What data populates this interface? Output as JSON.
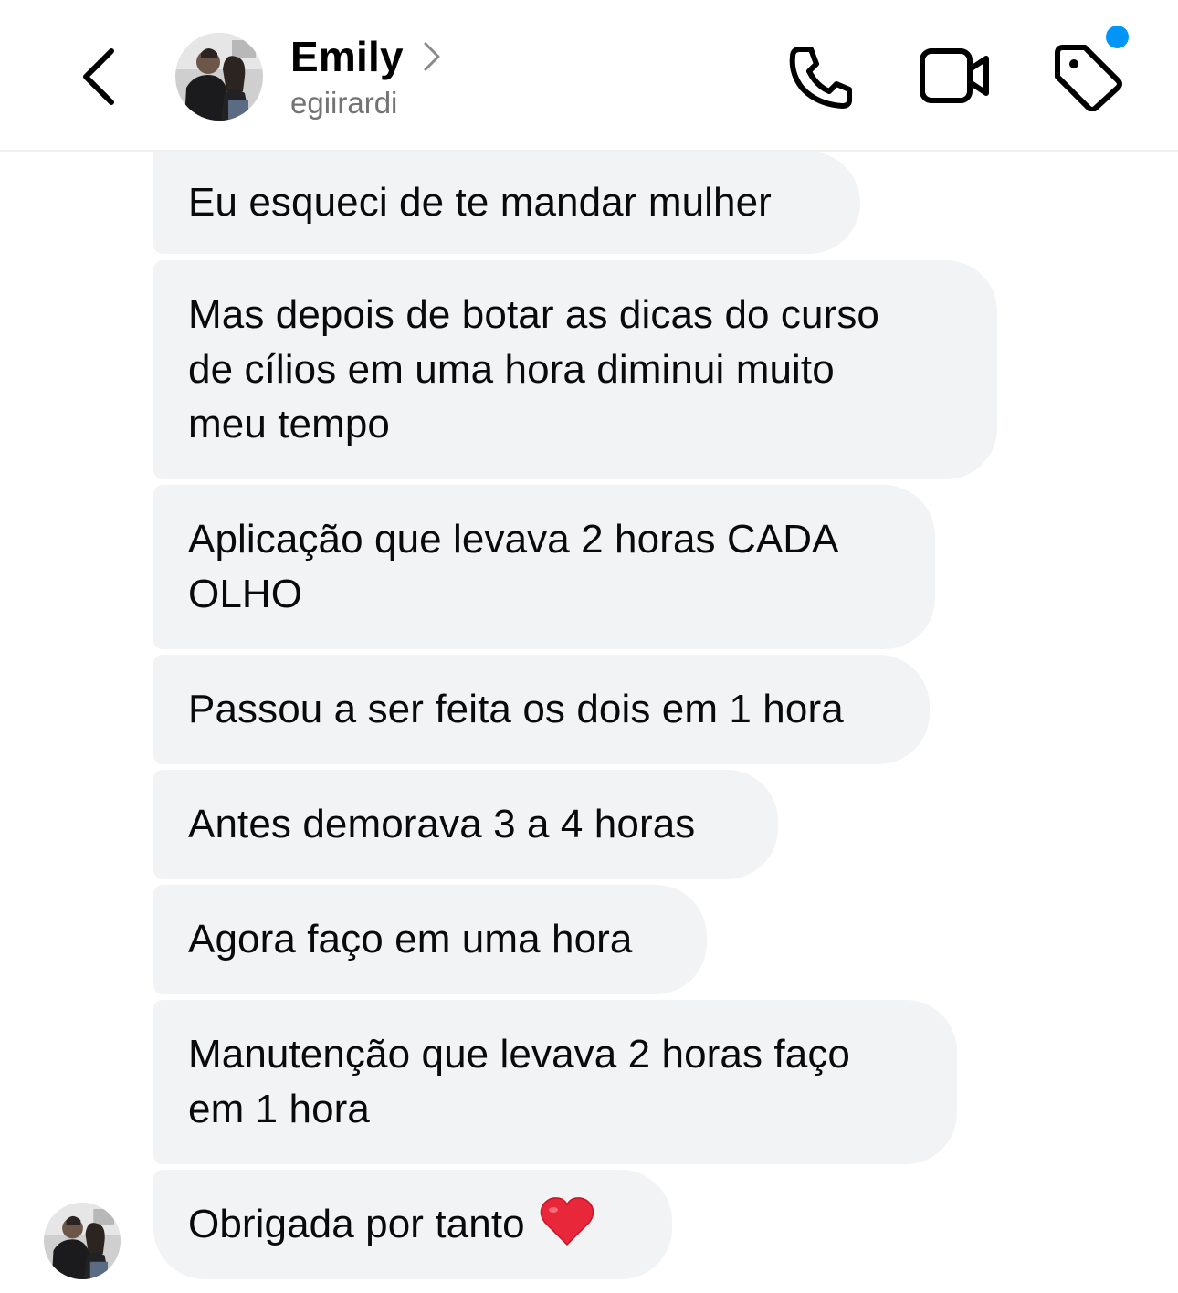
{
  "header": {
    "contact_name": "Emily",
    "contact_handle": "egiirardi",
    "icons": {
      "back": "chevron-left-icon",
      "profile_arrow": "chevron-right-icon",
      "call": "phone-icon",
      "video": "video-camera-icon",
      "tag": "tag-icon"
    },
    "notification_dot_color": "#0095f6"
  },
  "messages": [
    "Eu esqueci de te mandar mulher",
    "Mas depois de botar as dicas do curso\nde cílios em uma hora diminui muito\nmeu tempo",
    "Aplicação que levava 2 horas CADA\nOLHO",
    "Passou a ser feita os dois em 1 hora",
    "Antes demorava 3 a 4 horas",
    "Agora faço em uma hora",
    "Manutenção que levava 2 horas faço\nem 1 hora",
    "Obrigada por tanto"
  ],
  "last_message_emoji": "heart-emoji",
  "colors": {
    "bubble_bg": "#f2f3f5",
    "handle_text": "#737373",
    "heart": "#e8283a"
  }
}
